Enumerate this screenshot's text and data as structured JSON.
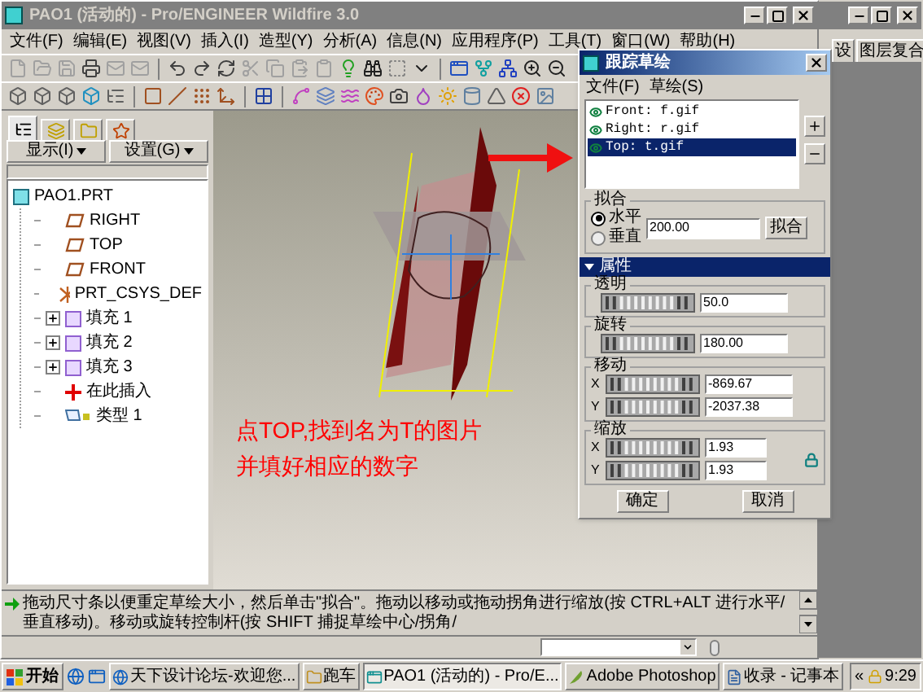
{
  "main_window": {
    "title": "PAO1 (活动的) - Pro/ENGINEER Wildfire 3.0",
    "menu": [
      "文件(F)",
      "编辑(E)",
      "视图(V)",
      "插入(I)",
      "造型(Y)",
      "分析(A)",
      "信息(N)",
      "应用程序(P)",
      "工具(T)",
      "窗口(W)",
      "帮助(H)"
    ],
    "panel_tabs": [
      {
        "selected": true
      },
      {
        "selected": false
      },
      {
        "selected": false
      },
      {
        "selected": false
      }
    ],
    "panel_buttons": [
      "显示(I)",
      "设置(G)"
    ],
    "model_tree": [
      {
        "label": "PAO1.PRT",
        "kind": "part",
        "children": [
          {
            "label": "RIGHT",
            "kind": "plane"
          },
          {
            "label": "TOP",
            "kind": "plane"
          },
          {
            "label": "FRONT",
            "kind": "plane"
          },
          {
            "label": "PRT_CSYS_DEF",
            "kind": "csys"
          },
          {
            "label": "填充 1",
            "kind": "fill",
            "expanded": false
          },
          {
            "label": "填充 2",
            "kind": "fill",
            "expanded": false
          },
          {
            "label": "填充 3",
            "kind": "fill",
            "expanded": false
          },
          {
            "label": "在此插入",
            "kind": "insert"
          },
          {
            "label": "类型 1",
            "kind": "style"
          }
        ]
      }
    ],
    "annotation": [
      "点TOP,找到名为T的图片",
      "并填好相应的数字"
    ],
    "status_message": "拖动尺寸条以便重定草绘大小，然后单击\"拟合\"。拖动以移动或拖动拐角进行缩放(按 CTRL+ALT 进行水平/垂直移动)。移动或旋转控制杆(按 SHIFT 捕捉草绘中心/拐角/"
  },
  "background_window": {
    "tabs": [
      "设",
      "图层复合"
    ]
  },
  "sketch_dialog": {
    "title": "跟踪草绘",
    "menu": [
      "文件(F)",
      "草绘(S)"
    ],
    "images": [
      {
        "label": "Front: f.gif",
        "selected": false
      },
      {
        "label": "Right: r.gif",
        "selected": false
      },
      {
        "label": "Top: t.gif",
        "selected": true
      }
    ],
    "fit": {
      "title": "拟合",
      "options": [
        {
          "label": "水平",
          "selected": true
        },
        {
          "label": "垂直",
          "selected": false
        }
      ],
      "value": "200.00",
      "button": "拟合"
    },
    "properties": {
      "title": "属性",
      "expanded": true,
      "groups": [
        {
          "title": "透明",
          "rows": [
            {
              "value": "50.0"
            }
          ]
        },
        {
          "title": "旋转",
          "rows": [
            {
              "value": "180.00"
            }
          ]
        },
        {
          "title": "移动",
          "rows": [
            {
              "axis": "X",
              "value": "-869.67"
            },
            {
              "axis": "Y",
              "value": "-2037.38"
            }
          ]
        },
        {
          "title": "缩放",
          "lock": true,
          "rows": [
            {
              "axis": "X",
              "value": "1.93"
            },
            {
              "axis": "Y",
              "value": "1.93"
            }
          ]
        }
      ]
    },
    "buttons": [
      "确定",
      "取消"
    ]
  },
  "taskbar": {
    "start": "开始",
    "tasks": [
      {
        "label": "天下设计论坛-欢迎您...",
        "kind": "browser",
        "selected": false
      },
      {
        "label": "跑车",
        "kind": "folder",
        "selected": false
      },
      {
        "label": "PAO1 (活动的) - Pro/E...",
        "kind": "cad",
        "selected": true
      },
      {
        "label": "Adobe Photoshop",
        "kind": "photoshop",
        "selected": false
      },
      {
        "label": "收录 - 记事本",
        "kind": "notepad",
        "selected": false
      }
    ],
    "tray_toggle": "«",
    "clock": "9:29"
  }
}
